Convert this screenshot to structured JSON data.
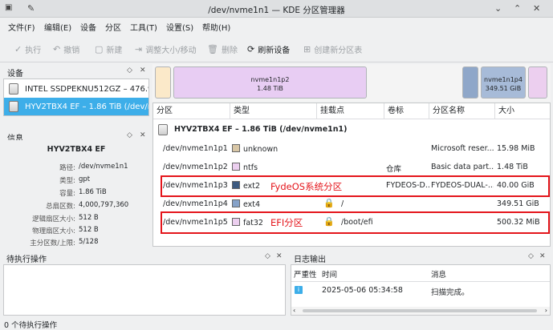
{
  "window": {
    "title": "/dev/nvme1n1 — KDE 分区管理器"
  },
  "menu": [
    "文件(F)",
    "编辑(E)",
    "设备",
    "分区",
    "工具(T)",
    "设置(S)",
    "帮助(H)"
  ],
  "toolbar": {
    "apply": "执行",
    "undo": "撤销",
    "new": "新建",
    "resize": "调整大小/移动",
    "delete": "删除",
    "refresh": "刷新设备",
    "new_table": "创建新分区表"
  },
  "devices_panel": {
    "title": "设备",
    "items": [
      "INTEL SSDPEKNU512GZ – 476.94 ...",
      "HYV2TBX4 EF – 1.86 TiB (/dev/nvm..."
    ]
  },
  "info_panel": {
    "title": "信息",
    "device": "HYV2TBX4 EF",
    "rows": [
      {
        "k": "路径:",
        "v": "/dev/nvme1n1"
      },
      {
        "k": "类型:",
        "v": "gpt"
      },
      {
        "k": "容量:",
        "v": "1.86 TiB"
      },
      {
        "k": "总扇区数:",
        "v": "4,000,797,360"
      },
      {
        "k": "逻辑扇区大小:",
        "v": "512 B"
      },
      {
        "k": "物理扇区大小:",
        "v": "512 B"
      },
      {
        "k": "主分区数/上限:",
        "v": "5/128"
      }
    ]
  },
  "partition_bar": {
    "p2_name": "nvme1n1p2",
    "p2_size": "1.48 TiB",
    "p4_name": "nvme1n1p4",
    "p4_size": "349.51 GiB"
  },
  "table": {
    "headers": [
      "分区",
      "类型",
      "挂载点",
      "卷标",
      "分区名称",
      "大小"
    ],
    "device_row": "HYV2TBX4 EF  – 1.86 TiB (/dev/nvme1n1)",
    "rows": [
      {
        "part": "/dev/nvme1n1p1",
        "type": "unknown",
        "color": "#d9c7a6",
        "mount": "",
        "label": "",
        "name": "Microsoft reser...",
        "size": "15.98 MiB",
        "locked": false
      },
      {
        "part": "/dev/nvme1n1p2",
        "type": "ntfs",
        "color": "#eccfef",
        "mount": "",
        "label": "仓库",
        "name": "Basic data part...",
        "size": "1.48 TiB",
        "locked": false
      },
      {
        "part": "/dev/nvme1n1p3",
        "type": "ext2",
        "color": "#3d5a80",
        "mount": "",
        "label": "FYDEOS-D...",
        "name": "FYDEOS-DUAL-...",
        "size": "40.00 GiB",
        "locked": false
      },
      {
        "part": "/dev/nvme1n1p4",
        "type": "ext4",
        "color": "#86a2c8",
        "mount": "/",
        "label": "",
        "name": "",
        "size": "349.51 GiB",
        "locked": true
      },
      {
        "part": "/dev/nvme1n1p5",
        "type": "fat32",
        "color": "#eccfef",
        "mount": "/boot/efi",
        "label": "",
        "name": "",
        "size": "500.32 MiB",
        "locked": true
      }
    ]
  },
  "annotations": {
    "fyde": "FydeOS系统分区",
    "efi": "EFI分区"
  },
  "pending_panel": {
    "title": "待执行操作"
  },
  "log_panel": {
    "title": "日志输出",
    "headers": [
      "严重性",
      "时间",
      "消息"
    ],
    "rows": [
      {
        "time": "2025-05-06 05:34:58",
        "msg": "扫描完成。"
      }
    ]
  },
  "status": "0 个待执行操作"
}
